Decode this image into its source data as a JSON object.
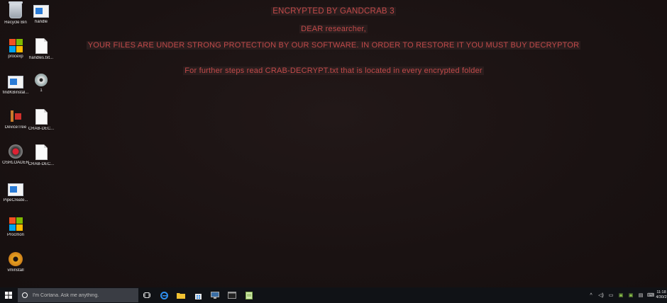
{
  "ransom_note": {
    "line1": "ENCRYPTED BY GANDCRAB 3",
    "line2": "DEAR researcher,",
    "line3": "YOUR FILES ARE UNDER STRONG PROTECTION BY OUR SOFTWARE. IN ORDER TO RESTORE IT YOU MUST BUY DECRYPTOR",
    "line4": "For further steps read CRAB-DECRYPT.txt that is located in every encrypted folder",
    "text_color": "#c24a4a"
  },
  "desktop_icons": [
    {
      "label": "Recycle Bin",
      "icon": "recycle-bin-icon"
    },
    {
      "label": "handle",
      "icon": "app-window-icon"
    },
    {
      "label": "procexp",
      "icon": "windows-flag-icon"
    },
    {
      "label": "handles.txt...",
      "icon": "text-file-icon"
    },
    {
      "label": "findKBinstal...",
      "icon": "app-window-icon"
    },
    {
      "label": "1",
      "icon": "disc-icon"
    },
    {
      "label": "DeviceTree",
      "icon": "device-tree-icon"
    },
    {
      "label": "CRAB-DEC...",
      "icon": "text-file-icon"
    },
    {
      "label": "OSRLOADER",
      "icon": "osrloader-icon"
    },
    {
      "label": "CRAB-DEC...",
      "icon": "text-file-icon"
    },
    {
      "label": "PipeCreate...",
      "icon": "app-window-icon"
    },
    {
      "label": "Procmon",
      "icon": "windows-flag-icon"
    },
    {
      "label": "vminstall",
      "icon": "gear-icon"
    }
  ],
  "taskbar": {
    "search_placeholder": "I'm Cortana. Ask me anything.",
    "clock_time": "11:18",
    "clock_date": "4/30/2",
    "accent": "#101216"
  }
}
